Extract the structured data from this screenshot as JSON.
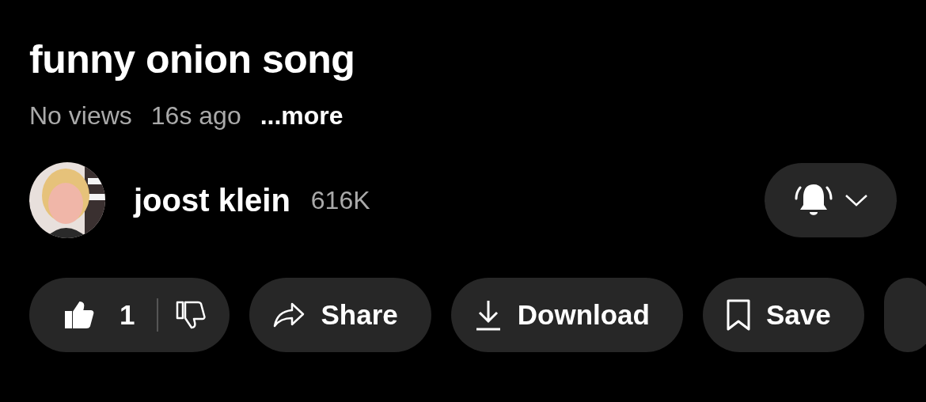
{
  "video": {
    "title": "funny onion song",
    "views": "No views",
    "age": "16s ago",
    "more": "...more"
  },
  "channel": {
    "name": "joost klein",
    "subscribers": "616K",
    "bell_ringing": true
  },
  "actions": {
    "like": {
      "count": "1",
      "liked": true
    },
    "buttons": [
      {
        "kind": "share",
        "label": "Share"
      },
      {
        "kind": "download",
        "label": "Download"
      },
      {
        "kind": "save",
        "label": "Save"
      },
      {
        "kind": "more"
      }
    ]
  }
}
